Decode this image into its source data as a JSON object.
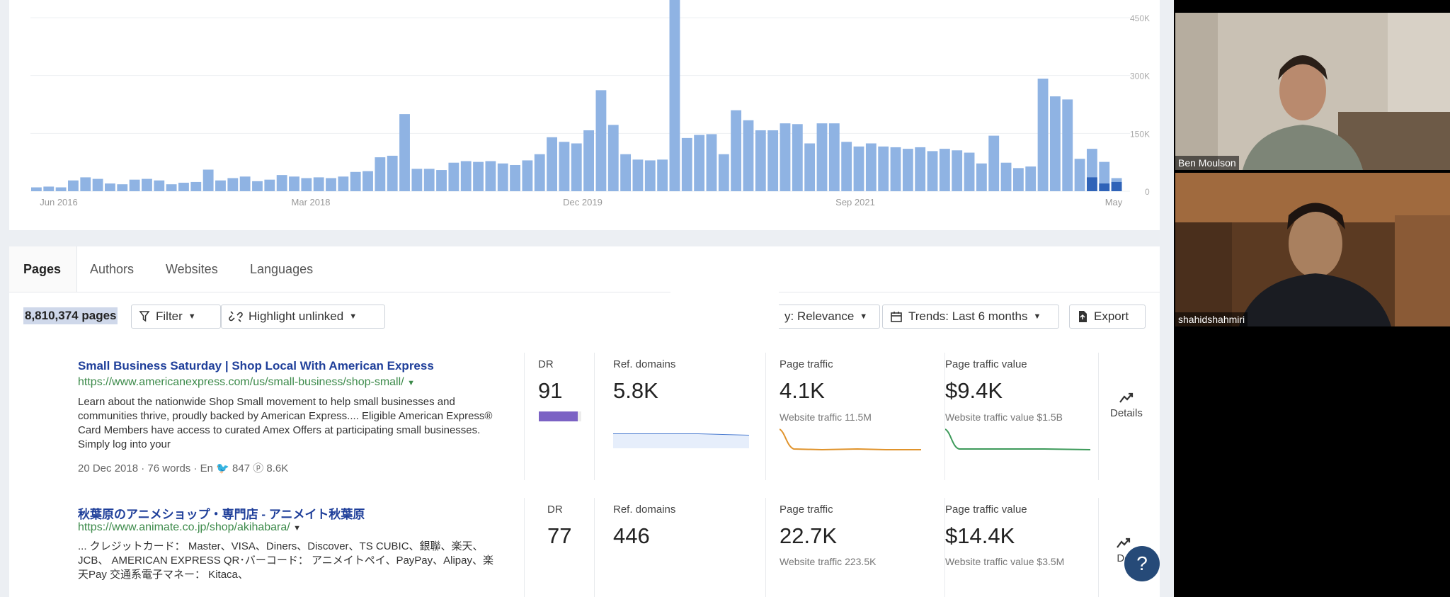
{
  "chart_data": {
    "type": "bar",
    "x_tick_labels": [
      "Jun 2016",
      "Mar 2018",
      "Dec 2019",
      "Sep 2021",
      "May"
    ],
    "y_tick_labels": [
      "450K",
      "300K",
      "150K",
      "0"
    ],
    "ylim": [
      0,
      520000
    ],
    "grid": true,
    "values": [
      10000,
      12000,
      10000,
      28000,
      36000,
      32000,
      20000,
      18000,
      30000,
      32000,
      28000,
      18000,
      22000,
      24000,
      56000,
      28000,
      34000,
      38000,
      26000,
      30000,
      42000,
      38000,
      34000,
      36000,
      34000,
      38000,
      50000,
      52000,
      88000,
      92000,
      200000,
      58000,
      58000,
      55000,
      74000,
      78000,
      76000,
      78000,
      72000,
      68000,
      80000,
      96000,
      140000,
      128000,
      124000,
      158000,
      262000,
      172000,
      96000,
      82000,
      80000,
      82000,
      520000,
      138000,
      146000,
      148000,
      96000,
      210000,
      184000,
      158000,
      158000,
      176000,
      174000,
      124000,
      176000,
      176000,
      128000,
      116000,
      124000,
      116000,
      114000,
      110000,
      114000,
      104000,
      110000,
      106000,
      100000,
      72000,
      144000,
      74000,
      60000,
      64000,
      292000,
      246000,
      238000,
      84000,
      110000,
      76000,
      34000
    ],
    "highlight_values": [
      0,
      0,
      0,
      0,
      0,
      0,
      0,
      0,
      0,
      0,
      0,
      0,
      0,
      0,
      0,
      0,
      0,
      0,
      0,
      0,
      0,
      0,
      0,
      0,
      0,
      0,
      0,
      0,
      0,
      0,
      0,
      0,
      0,
      0,
      0,
      0,
      0,
      0,
      0,
      0,
      0,
      0,
      0,
      0,
      0,
      0,
      0,
      0,
      0,
      0,
      0,
      0,
      0,
      0,
      0,
      0,
      0,
      0,
      0,
      0,
      0,
      0,
      0,
      0,
      0,
      0,
      0,
      0,
      0,
      0,
      0,
      0,
      0,
      0,
      0,
      0,
      0,
      0,
      0,
      0,
      0,
      0,
      0,
      0,
      0,
      0,
      36000,
      20000,
      24000
    ]
  },
  "tabs": [
    "Pages",
    "Authors",
    "Websites",
    "Languages"
  ],
  "toolbar": {
    "count": "8,810,374 pages",
    "filter": "Filter",
    "highlight": "Highlight unlinked",
    "sort": "y: Relevance",
    "trends": "Trends: Last 6 months",
    "export": "Export"
  },
  "results": [
    {
      "title": "Small Business Saturday | Shop Local With American Express",
      "url": "https://www.americanexpress.com/us/small-business/shop-small/",
      "description": "Learn about the nationwide Shop Small movement to help small businesses and communities thrive, proudly backed by American Express.... Eligible American Express® Card Members have access to curated Amex Offers at participating small businesses. Simply log into your",
      "date": "20 Dec 2018",
      "words": "76 words",
      "lang": "En",
      "twitter": "847",
      "pinterest": "8.6K",
      "dr_label": "DR",
      "dr": "91",
      "ref_label": "Ref. domains",
      "ref": "5.8K",
      "traffic_label": "Page traffic",
      "traffic": "4.1K",
      "traffic_sub": "Website traffic 11.5M",
      "value_label": "Page traffic value",
      "value": "$9.4K",
      "value_sub": "Website traffic value $1.5B",
      "details": "Details"
    },
    {
      "title": "秋葉原のアニメショップ・専門店 - アニメイト秋葉原",
      "url": "https://www.animate.co.jp/shop/akihabara/",
      "description": "... クレジットカード： Master、VISA、Diners、Discover、TS CUBIC、銀聯、楽天、JCB、 AMERICAN EXPRESS QR･バーコード： アニメイトペイ、PayPay、Alipay、楽天Pay 交通系電子マネー： Kitaca、",
      "dr_label": "DR",
      "dr": "77",
      "ref_label": "Ref. domains",
      "ref": "446",
      "traffic_label": "Page traffic",
      "traffic": "22.7K",
      "traffic_sub": "Website traffic 223.5K",
      "value_label": "Page traffic value",
      "value": "$14.4K",
      "value_sub": "Website traffic value $3.5M",
      "details": "De"
    }
  ],
  "help": "?",
  "participants": [
    {
      "name": "Ben Moulson"
    },
    {
      "name": "shahidshahmiri"
    }
  ],
  "colors": {
    "bar": "#8fb3e3",
    "bar_highlight": "#2f63b8",
    "dr_bar": "#7b62c4",
    "ref_line": "#4a7bd0",
    "traffic_line": "#e0932b",
    "value_line": "#3d9a5a"
  }
}
